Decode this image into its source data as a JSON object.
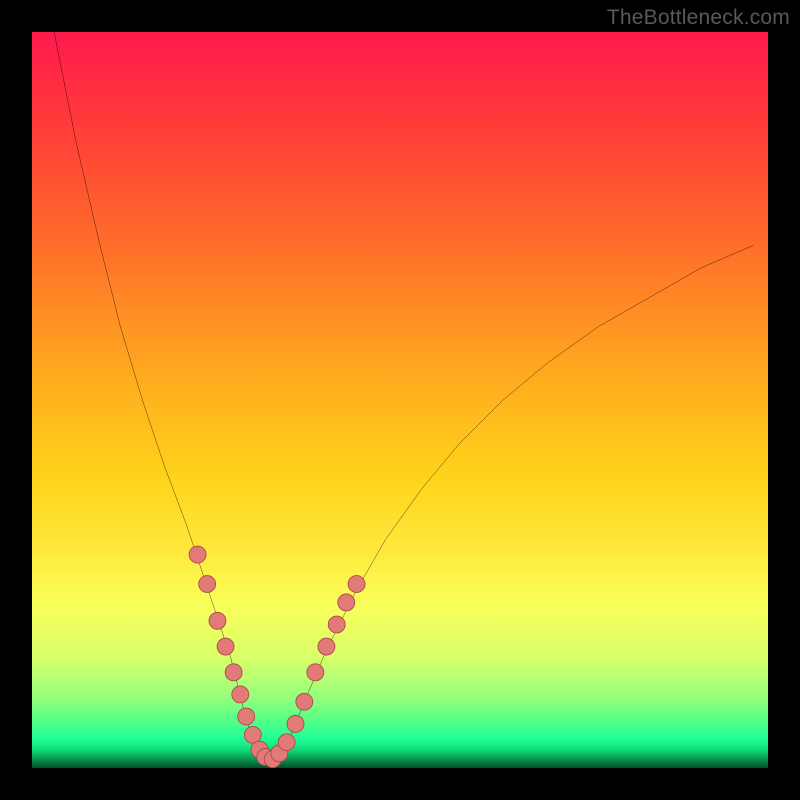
{
  "watermark": "TheBottleneck.com",
  "colors": {
    "frame_border": "#000000",
    "curve_stroke": "#000000",
    "marker_fill": "#e27b78",
    "marker_stroke": "#a84a47",
    "gradient_top": "#ff1a4d",
    "gradient_bottom": "#044f28"
  },
  "chart_data": {
    "type": "line",
    "title": "",
    "xlabel": "",
    "ylabel": "",
    "xlim": [
      0,
      100
    ],
    "ylim": [
      0,
      100
    ],
    "grid": false,
    "legend": false,
    "series": [
      {
        "name": "bottleneck-curve",
        "x": [
          3,
          6,
          9,
          12,
          15,
          18,
          21,
          23,
          25,
          27,
          28,
          29,
          30,
          31,
          32,
          33,
          34,
          35,
          37,
          40,
          44,
          48,
          53,
          58,
          64,
          70,
          77,
          84,
          91,
          98
        ],
        "y": [
          100,
          85,
          72,
          60,
          50,
          41,
          33,
          27,
          21,
          15,
          11,
          7,
          4,
          2,
          1,
          1,
          2,
          4,
          9,
          16,
          24,
          31,
          38,
          44,
          50,
          55,
          60,
          64,
          68,
          71
        ]
      }
    ],
    "markers": {
      "name": "highlight-points",
      "x": [
        22.5,
        23.8,
        25.2,
        26.3,
        27.4,
        28.3,
        29.1,
        30.0,
        30.9,
        31.7,
        32.7,
        33.6,
        34.6,
        35.8,
        37.0,
        38.5,
        40.0,
        41.4,
        42.7,
        44.1
      ],
      "y": [
        29.0,
        25.0,
        20.0,
        16.5,
        13.0,
        10.0,
        7.0,
        4.5,
        2.5,
        1.5,
        1.2,
        2.0,
        3.5,
        6.0,
        9.0,
        13.0,
        16.5,
        19.5,
        22.5,
        25.0
      ]
    }
  }
}
